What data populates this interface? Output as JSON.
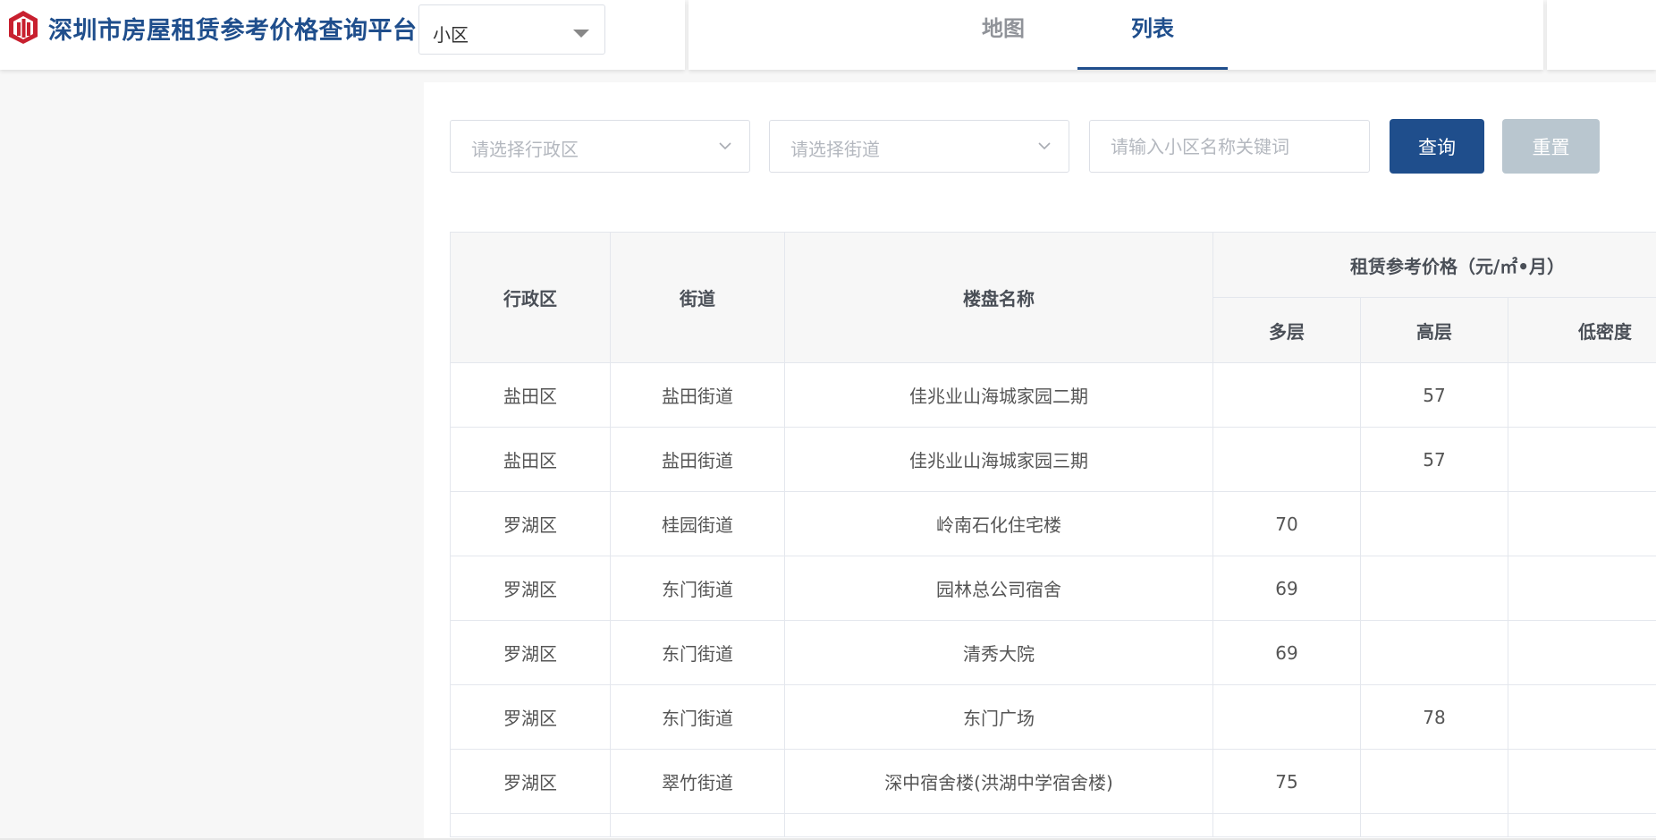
{
  "header": {
    "title": "深圳市房屋租赁参考价格查询平台",
    "search_type": "小区",
    "tabs": [
      {
        "label": "地图",
        "active": false
      },
      {
        "label": "列表",
        "active": true
      }
    ]
  },
  "filters": {
    "district_placeholder": "请选择行政区",
    "street_placeholder": "请选择街道",
    "keyword_placeholder": "请输入小区名称关键词",
    "query_label": "查询",
    "reset_label": "重置"
  },
  "table": {
    "headers": {
      "district": "行政区",
      "street": "街道",
      "estate": "楼盘名称",
      "price_group": "租赁参考价格（元/㎡•月）",
      "multi": "多层",
      "high": "高层",
      "low": "低密度"
    },
    "rows": [
      {
        "district": "盐田区",
        "street": "盐田街道",
        "estate": "佳兆业山海城家园二期",
        "multi": "",
        "high": "57",
        "low": ""
      },
      {
        "district": "盐田区",
        "street": "盐田街道",
        "estate": "佳兆业山海城家园三期",
        "multi": "",
        "high": "57",
        "low": ""
      },
      {
        "district": "罗湖区",
        "street": "桂园街道",
        "estate": "岭南石化住宅楼",
        "multi": "70",
        "high": "",
        "low": ""
      },
      {
        "district": "罗湖区",
        "street": "东门街道",
        "estate": "园林总公司宿舍",
        "multi": "69",
        "high": "",
        "low": ""
      },
      {
        "district": "罗湖区",
        "street": "东门街道",
        "estate": "清秀大院",
        "multi": "69",
        "high": "",
        "low": ""
      },
      {
        "district": "罗湖区",
        "street": "东门街道",
        "estate": "东门广场",
        "multi": "",
        "high": "78",
        "low": ""
      },
      {
        "district": "罗湖区",
        "street": "翠竹街道",
        "estate": "深中宿舍楼(洪湖中学宿舍楼)",
        "multi": "75",
        "high": "",
        "low": ""
      }
    ]
  },
  "colors": {
    "brand": "#1f4e8c",
    "reset_button": "#b9c6cf",
    "logo_red": "#c8202f"
  },
  "icons": {
    "logo": "building-logo-icon",
    "dropdown": "caret-down-icon",
    "select": "chevron-down-icon"
  }
}
